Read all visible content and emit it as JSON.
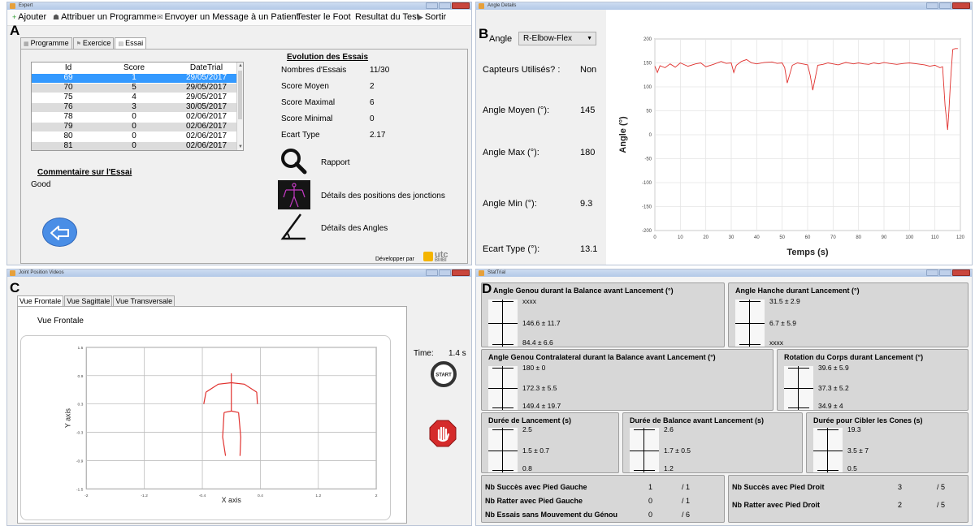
{
  "panel_letters": {
    "a": "A",
    "b": "B",
    "c": "C",
    "d": "D"
  },
  "panel_a": {
    "window_title": "Expert",
    "menu": [
      {
        "label": "Ajouter",
        "icon": "plus-icon"
      },
      {
        "label": "Attribuer un Programme",
        "icon": "users-icon"
      },
      {
        "label": "Envoyer un Message à un Patient",
        "icon": "mail-icon"
      },
      {
        "label": "Tester le Foot",
        "icon": ""
      },
      {
        "label": "Resultat du Test",
        "icon": ""
      },
      {
        "label": "Sortir",
        "icon": "exit-icon"
      }
    ],
    "tabs": [
      {
        "label": "Programme",
        "icon": "grid-icon"
      },
      {
        "label": "Exercice",
        "icon": "flag-icon"
      },
      {
        "label": "Essai",
        "icon": "document-icon"
      }
    ],
    "trial_table": {
      "columns": [
        "Id",
        "Score",
        "DateTrial"
      ],
      "rows": [
        {
          "id": "69",
          "score": "1",
          "date": "29/05/2017"
        },
        {
          "id": "70",
          "score": "5",
          "date": "29/05/2017"
        },
        {
          "id": "75",
          "score": "4",
          "date": "29/05/2017"
        },
        {
          "id": "76",
          "score": "3",
          "date": "30/05/2017"
        },
        {
          "id": "78",
          "score": "0",
          "date": "02/06/2017"
        },
        {
          "id": "79",
          "score": "0",
          "date": "02/06/2017"
        },
        {
          "id": "80",
          "score": "0",
          "date": "02/06/2017"
        },
        {
          "id": "81",
          "score": "0",
          "date": "02/06/2017"
        }
      ]
    },
    "evolution_title": "Evolution des Essais",
    "stats": [
      {
        "label": "Nombres d'Essais",
        "value": "11/30"
      },
      {
        "label": "Score Moyen",
        "value": "2"
      },
      {
        "label": "Score Maximal",
        "value": "6"
      },
      {
        "label": "Score Minimal",
        "value": "0"
      },
      {
        "label": "Ecart Type",
        "value": "2.17"
      }
    ],
    "comment_title": "Commentaire sur l'Essai",
    "comment_text": "Good",
    "actions": [
      {
        "label": "Rapport",
        "icon": "magnifier-icon"
      },
      {
        "label": "Détails des positions des jonctions",
        "icon": "skeleton-icon"
      },
      {
        "label": "Détails des Angles",
        "icon": "angle-icon"
      }
    ],
    "developer_label": "Développer par",
    "logo_text": {
      "main": "utc",
      "sub": "BMBI"
    }
  },
  "panel_b": {
    "window_title": "Angle Details",
    "angle_label": "Angle",
    "angle_selected": "R-Elbow-Flex",
    "rows": [
      {
        "label": "Capteurs Utilisés? :",
        "value": "Non"
      },
      {
        "label": "Angle Moyen (°):",
        "value": "145"
      },
      {
        "label": "Angle Max (°):",
        "value": "180"
      },
      {
        "label": "Angle Min (°):",
        "value": "9.3"
      },
      {
        "label": "Ecart Type (°):",
        "value": "13.1"
      }
    ]
  },
  "panel_c": {
    "window_title": "Joint Position Videos",
    "tabs": [
      "Vue Frontale",
      "Vue Sagittale",
      "Vue Transversale"
    ],
    "view_title": "Vue Frontale",
    "time_label": "Time:",
    "time_value": "1.4 s",
    "start_label": "START"
  },
  "panel_d": {
    "window_title": "StatTrial",
    "groups": [
      {
        "title": "Angle Genou durant la Balance avant Lancement (°)",
        "top": "xxxx",
        "mid": "146.6  ±  11.7",
        "bottom": "84.4  ±  6.6"
      },
      {
        "title": "Angle Hanche durant Lancement (°)",
        "top": "31.5  ±  2.9",
        "mid": "6.7   ±  5.9",
        "bottom": "xxxx"
      },
      {
        "title": "Angle Genou Contralateral durant la Balance avant Lancement (°)",
        "top": "180  ±  0",
        "mid": "172.3  ±  5.5",
        "bottom": "149.4  ±  19.7"
      },
      {
        "title": "Rotation du Corps durant Lancement (°)",
        "top": "39.6  ±  5.9",
        "mid": "37.3  ±  5.2",
        "bottom": "34.9  ±  4"
      },
      {
        "title": "Durée de Lancement (s)",
        "top": "2.5",
        "mid": "1.5   ±   0.7",
        "bottom": "0.8"
      },
      {
        "title": "Durée de Balance avant Lancement (s)",
        "top": "2.6",
        "mid": "1.7  ±  0.5",
        "bottom": "1.2"
      },
      {
        "title": "Durée pour Cibler les Cones (s)",
        "top": "19.3",
        "mid": "3.5   ±  7",
        "bottom": "0.5"
      }
    ],
    "counts_left": [
      {
        "label": "Nb Succès avec Pied Gauche",
        "value": "1",
        "total": "/ 1"
      },
      {
        "label": "Nb Ratter avec Pied Gauche",
        "value": "0",
        "total": "/ 1"
      },
      {
        "label": "Nb Essais sans Mouvement du Génou",
        "value": "0",
        "total": "/ 6"
      }
    ],
    "counts_right": [
      {
        "label": "Nb Succès avec Pied Droit",
        "value": "3",
        "total": "/ 5"
      },
      {
        "label": "Nb Ratter avec Pied Droit",
        "value": "2",
        "total": "/ 5"
      }
    ]
  },
  "chart_data": [
    {
      "type": "line",
      "title": "",
      "xlabel": "Temps (s)",
      "ylabel": "Angle (°)",
      "xlim": [
        0,
        120
      ],
      "ylim": [
        -200,
        200
      ],
      "xticks": [
        0,
        10,
        20,
        30,
        40,
        50,
        60,
        70,
        80,
        90,
        100,
        110,
        120
      ],
      "yticks": [
        200,
        150,
        100,
        50,
        0,
        -50,
        -100,
        -150,
        -200
      ],
      "grid": true,
      "color": "#e0302d",
      "series": [
        {
          "x": [
            0,
            1,
            2,
            4,
            6,
            8,
            10,
            13,
            16,
            18,
            20,
            23,
            26,
            28,
            30,
            31,
            32,
            34,
            36,
            38,
            40,
            43,
            46,
            48,
            50,
            51,
            52,
            54,
            56,
            58,
            60,
            61,
            62,
            64,
            66,
            68,
            70,
            72,
            75,
            78,
            80,
            82,
            84,
            86,
            88,
            90,
            92,
            95,
            98,
            100,
            103,
            106,
            108,
            110,
            112,
            113,
            114,
            114.5,
            115,
            115.5,
            116,
            116.5,
            117,
            118,
            119
          ],
          "y": [
            143,
            130,
            144,
            140,
            148,
            141,
            150,
            143,
            148,
            150,
            142,
            147,
            153,
            149,
            150,
            130,
            145,
            153,
            157,
            150,
            148,
            151,
            152,
            149,
            150,
            140,
            108,
            145,
            150,
            148,
            146,
            125,
            93,
            145,
            147,
            150,
            148,
            146,
            151,
            148,
            150,
            148,
            147,
            150,
            148,
            151,
            149,
            147,
            149,
            150,
            148,
            146,
            143,
            145,
            140,
            142,
            60,
            35,
            10,
            50,
            100,
            140,
            178,
            180,
            180
          ]
        }
      ]
    },
    {
      "type": "line",
      "title": "",
      "xlabel": "X axis",
      "ylabel": "Y axis",
      "xlim": [
        -2,
        2
      ],
      "ylim": [
        -1.5,
        1.5
      ],
      "xticks": [
        -2,
        -1.2,
        -0.4,
        0.4,
        1.2,
        2
      ],
      "yticks": [
        1.5,
        0.9,
        0.3,
        -0.3,
        -0.9,
        -1.5
      ],
      "grid": true,
      "color": "#e0302d",
      "series": [
        {
          "x": [
            0.0,
            0.0,
            0.0
          ],
          "y": [
            0.95,
            0.75,
            0.15
          ]
        },
        {
          "x": [
            -0.35,
            -0.18,
            0.0,
            0.18,
            0.35
          ],
          "y": [
            0.55,
            0.72,
            0.75,
            0.72,
            0.55
          ]
        },
        {
          "x": [
            -0.35,
            -0.38
          ],
          "y": [
            0.55,
            0.3
          ]
        },
        {
          "x": [
            0.35,
            0.36
          ],
          "y": [
            0.55,
            0.3
          ]
        },
        {
          "x": [
            -0.1,
            0.0,
            0.1
          ],
          "y": [
            0.12,
            0.15,
            0.12
          ]
        },
        {
          "x": [
            -0.1,
            -0.12,
            -0.08
          ],
          "y": [
            0.12,
            -0.4,
            -0.8
          ]
        },
        {
          "x": [
            0.1,
            0.13,
            0.12
          ],
          "y": [
            0.12,
            -0.4,
            -0.8
          ]
        }
      ]
    }
  ]
}
